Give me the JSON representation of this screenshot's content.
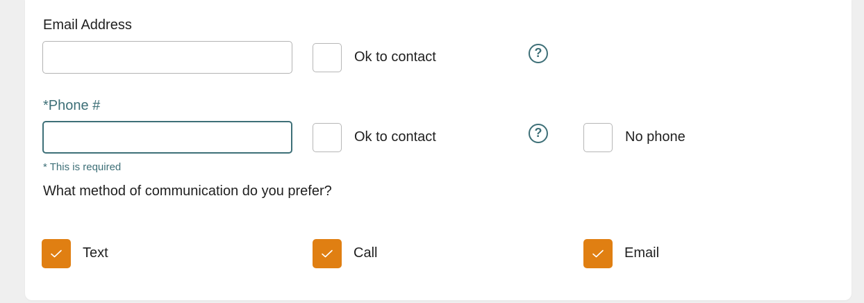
{
  "contact_form": {
    "email": {
      "label": "Email Address",
      "value": "",
      "placeholder": "",
      "ok_to_contact_label": "Ok to contact",
      "help_glyph": "?"
    },
    "phone": {
      "label": "*Phone #",
      "value": "",
      "placeholder": "",
      "ok_to_contact_label": "Ok to contact",
      "help_glyph": "?",
      "no_phone_label": "No phone",
      "required_message": "* This is required"
    },
    "preference": {
      "question": "What method of communication do you prefer?",
      "options": [
        {
          "label": "Text",
          "checked": true
        },
        {
          "label": "Call",
          "checked": true
        },
        {
          "label": "Email",
          "checked": true
        }
      ]
    }
  },
  "colors": {
    "accent_orange": "#e07f12",
    "teal": "#3d6f77",
    "page_background": "#efefef",
    "card_background": "#ffffff"
  },
  "icons": {
    "help": "question-circle-icon",
    "check": "check-icon"
  }
}
